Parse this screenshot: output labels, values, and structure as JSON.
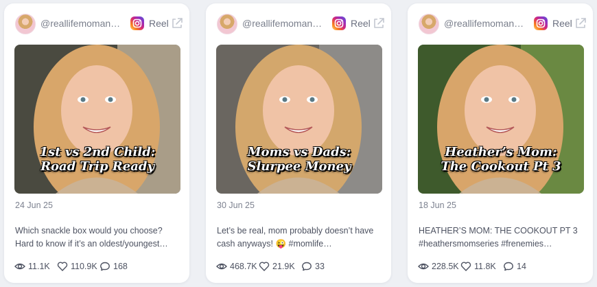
{
  "cards": [
    {
      "handle": "@reallifemomanddad",
      "platform": "Reel",
      "overlay_line1": "1st vs 2nd Child:",
      "overlay_line2": "Road Trip Ready",
      "date": "24 Jun 25",
      "caption_line1": "Which snackle box would you choose?",
      "caption_line2": "Hard to know if it’s an oldest/youngest…",
      "views": "11.1K",
      "likes": "110.9K",
      "comments": "168",
      "bg_colors": [
        "#4a4a40",
        "#c9b9a0",
        "#d8a66a"
      ]
    },
    {
      "handle": "@reallifemomanddad",
      "platform": "Reel",
      "overlay_line1": "Moms vs Dads:",
      "overlay_line2": "Slurpee Money",
      "date": "30 Jun 25",
      "caption_line1": "Let’s be real, mom probably doesn’t have",
      "caption_line2": "cash anyways! 😜 #momlife…",
      "views": "468.7K",
      "likes": "21.9K",
      "comments": "33",
      "bg_colors": [
        "#6a6660",
        "#9a9896",
        "#d3a76c"
      ]
    },
    {
      "handle": "@reallifemomanddad",
      "platform": "Reel",
      "overlay_line1": "Heather’s Mom:",
      "overlay_line2": "The Cookout Pt 3",
      "date": "18 Jun 25",
      "caption_line1": "HEATHER’S MOM: THE COOKOUT PT 3",
      "caption_line2": "#heathersmomseries #frenemies…",
      "views": "228.5K",
      "likes": "11.8K",
      "comments": "14",
      "bg_colors": [
        "#3e5a2c",
        "#7a9a4a",
        "#d8a56a"
      ]
    }
  ]
}
